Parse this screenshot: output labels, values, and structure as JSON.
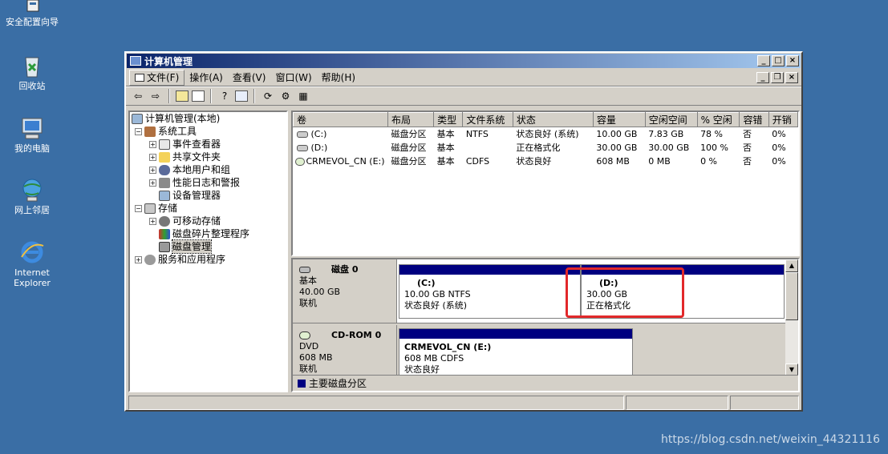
{
  "desktop": {
    "icons": [
      {
        "label": "安全配置向导",
        "icon": "wizard-icon"
      },
      {
        "label": "回收站",
        "icon": "recycle-bin-icon"
      },
      {
        "label": "我的电脑",
        "icon": "my-computer-icon"
      },
      {
        "label": "网上邻居",
        "icon": "network-icon"
      },
      {
        "label": "Internet Explorer",
        "icon": "ie-icon"
      }
    ]
  },
  "window": {
    "title": "计算机管理",
    "menu": [
      "文件(F)",
      "操作(A)",
      "查看(V)",
      "窗口(W)",
      "帮助(H)"
    ]
  },
  "tree": {
    "root": "计算机管理(本地)",
    "system_tools": "系统工具",
    "event_viewer": "事件查看器",
    "shared_folders": "共享文件夹",
    "local_users": "本地用户和组",
    "perf_logs": "性能日志和警报",
    "device_manager": "设备管理器",
    "storage": "存储",
    "removable": "可移动存储",
    "defrag": "磁盘碎片整理程序",
    "disk_mgmt": "磁盘管理",
    "services": "服务和应用程序"
  },
  "volume_table": {
    "headers": [
      "卷",
      "布局",
      "类型",
      "文件系统",
      "状态",
      "容量",
      "空闲空间",
      "% 空闲",
      "容错",
      "开销"
    ],
    "rows": [
      [
        "(C:)",
        "磁盘分区",
        "基本",
        "NTFS",
        "状态良好 (系统)",
        "10.00 GB",
        "7.83 GB",
        "78 %",
        "否",
        "0%"
      ],
      [
        "(D:)",
        "磁盘分区",
        "基本",
        "",
        "正在格式化",
        "30.00 GB",
        "30.00 GB",
        "100 %",
        "否",
        "0%"
      ],
      [
        "CRMEVOL_CN (E:)",
        "磁盘分区",
        "基本",
        "CDFS",
        "状态良好",
        "608 MB",
        "0 MB",
        "0 %",
        "否",
        "0%"
      ]
    ]
  },
  "disks": {
    "disk0": {
      "name": "磁盘 0",
      "type": "基本",
      "size": "40.00 GB",
      "status": "联机"
    },
    "disk0_c": {
      "name": "(C:)",
      "detail": "10.00 GB NTFS",
      "status": "状态良好 (系统)"
    },
    "disk0_d": {
      "name": "(D:)",
      "detail": "30.00 GB",
      "status": "正在格式化"
    },
    "cdrom0": {
      "name": "CD-ROM 0",
      "type": "DVD",
      "size": "608 MB",
      "status": "联机"
    },
    "cdrom0_e": {
      "name": "CRMEVOL_CN  (E:)",
      "detail": "608 MB CDFS",
      "status": "状态良好"
    }
  },
  "legend": {
    "primary_partition": "主要磁盘分区"
  },
  "watermark": "https://blog.csdn.net/weixin_44321116"
}
